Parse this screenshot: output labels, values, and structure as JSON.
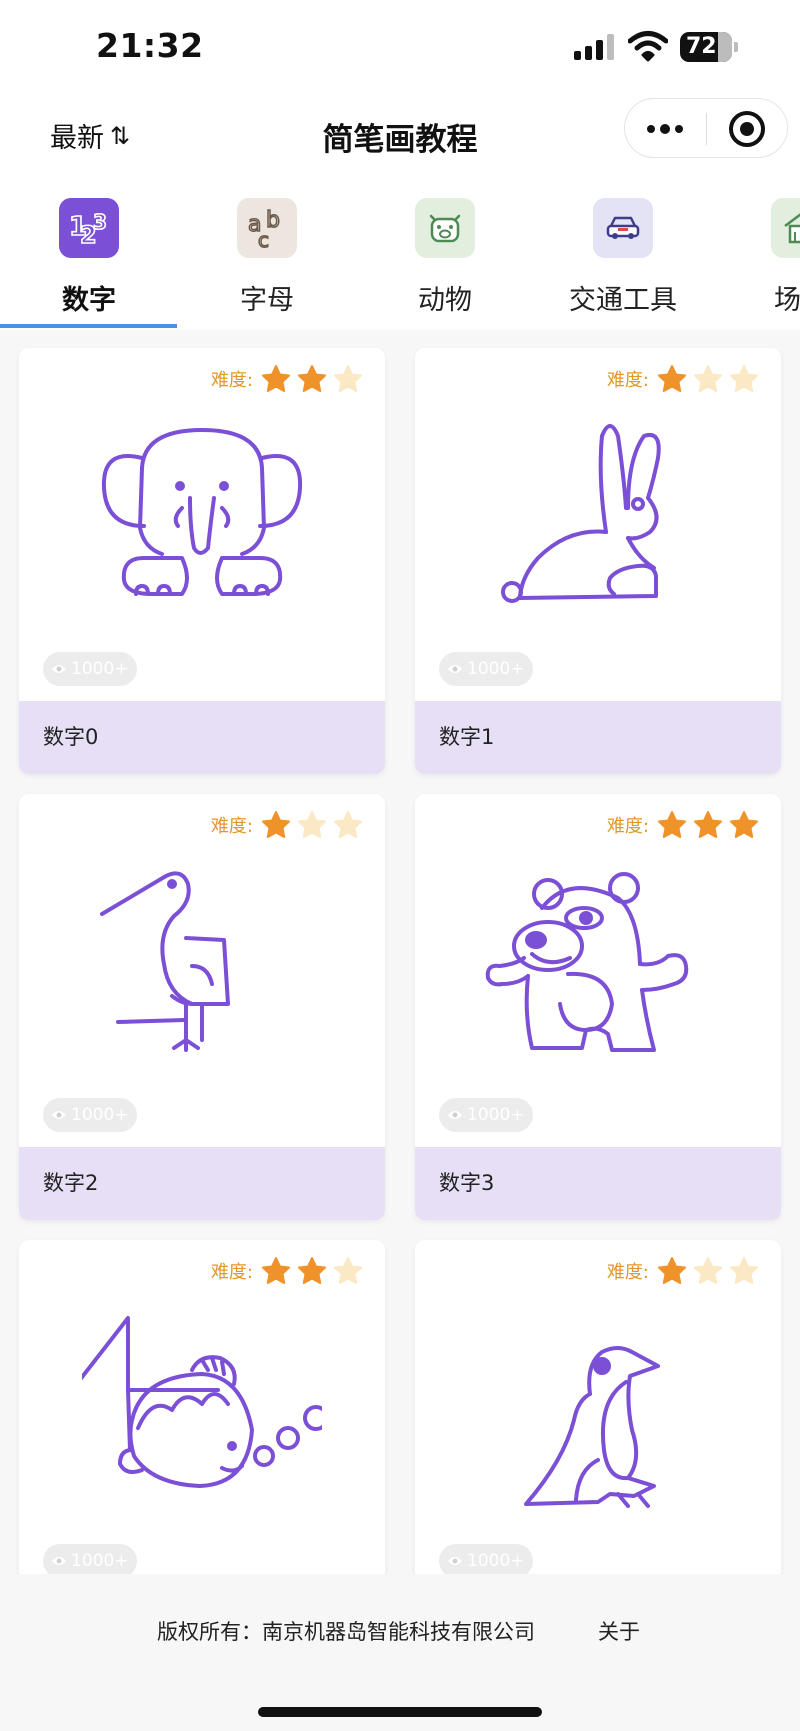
{
  "status_bar": {
    "time": "21:32",
    "battery": "72"
  },
  "nav": {
    "sort_label": "最新",
    "sort_icon": "⇅",
    "title": "简笔画教程",
    "more_icon": "more-dots-icon",
    "close_icon": "target-circle-icon"
  },
  "tabs": [
    {
      "label": "数字",
      "icon": "numbers-icon",
      "active": true
    },
    {
      "label": "字母",
      "icon": "letters-icon",
      "active": false
    },
    {
      "label": "动物",
      "icon": "pig-face-icon",
      "active": false
    },
    {
      "label": "交通工具",
      "icon": "car-icon",
      "active": false
    },
    {
      "label": "场景",
      "icon": "house-icon",
      "active": false
    }
  ],
  "difficulty_label": "难度:",
  "cards": [
    {
      "title": "数字0",
      "views": "1000+",
      "difficulty": 2,
      "drawing": "elephant"
    },
    {
      "title": "数字1",
      "views": "1000+",
      "difficulty": 1,
      "drawing": "rabbit"
    },
    {
      "title": "数字2",
      "views": "1000+",
      "difficulty": 1,
      "drawing": "bird"
    },
    {
      "title": "数字3",
      "views": "1000+",
      "difficulty": 3,
      "drawing": "bear"
    },
    {
      "title": "",
      "views": "1000+",
      "difficulty": 2,
      "drawing": "fish"
    },
    {
      "title": "",
      "views": "1000+",
      "difficulty": 1,
      "drawing": "penguin"
    }
  ],
  "footer": {
    "copyright": "版权所有：南京机器岛智能科技有限公司",
    "about": "关于"
  },
  "colors": {
    "accent_purple": "#7b4fd6",
    "star_filled": "#f0922a",
    "star_empty": "#fbe8c4",
    "card_footer_bg": "#e6dff6",
    "tab_underline": "#4a8fe0"
  }
}
